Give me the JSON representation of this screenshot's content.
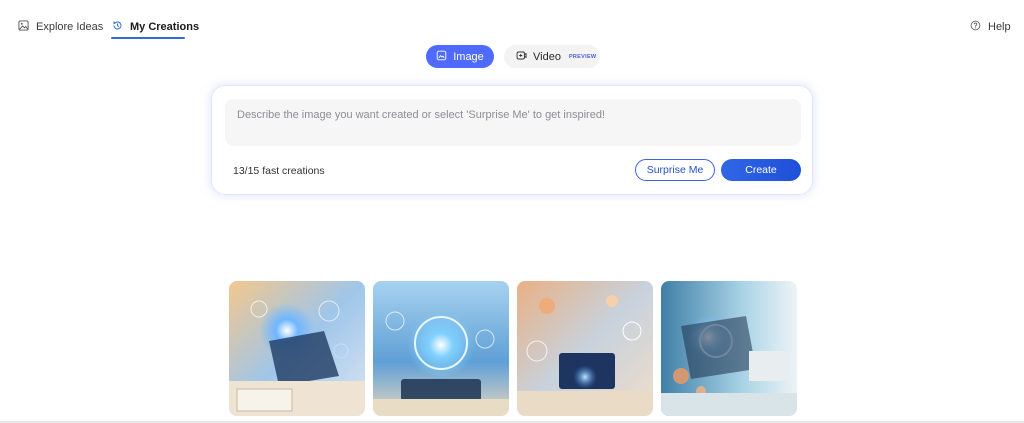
{
  "nav": {
    "explore_label": "Explore Ideas",
    "creations_label": "My Creations",
    "help_label": "Help",
    "accent": "#2f6ddb"
  },
  "mode": {
    "image_label": "Image",
    "video_label": "Video",
    "video_badge": "PREVIEW",
    "active": "Image"
  },
  "prompt": {
    "placeholder": "Describe the image you want created or select 'Surprise Me' to get inspired!",
    "fast_creations": "13/15 fast creations",
    "surprise_label": "Surprise Me",
    "create_label": "Create"
  },
  "gallery": {
    "items": [
      {
        "name": "creation-1",
        "palette": [
          "#f2c48a",
          "#3a7bd5",
          "#dfe9f5"
        ]
      },
      {
        "name": "creation-2",
        "palette": [
          "#8cc7f0",
          "#2a6fc9",
          "#e8eef5"
        ]
      },
      {
        "name": "creation-3",
        "palette": [
          "#e8a26f",
          "#4a88d8",
          "#f1dcc8"
        ]
      },
      {
        "name": "creation-4",
        "palette": [
          "#9ed0e6",
          "#e08a5a",
          "#dce9ef"
        ]
      }
    ]
  }
}
